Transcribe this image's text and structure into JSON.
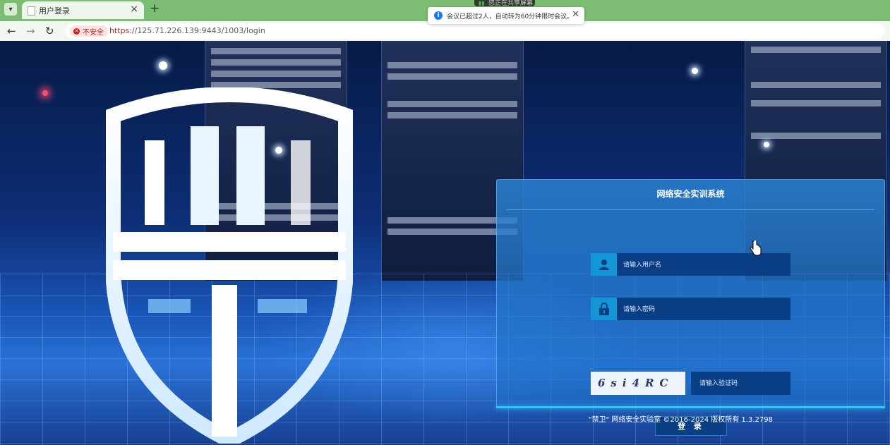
{
  "browser": {
    "tab_title": "用户登录",
    "tab_close": "×",
    "new_tab": "+",
    "share_indicator": "您正在共享屏幕",
    "address": {
      "security_label": "不安全",
      "url_scheme": "https",
      "url_rest": "://125.71.226.139:9443/1003/login"
    }
  },
  "notification": {
    "icon": "i",
    "message": "会议已超过2人，自动转为60分钟限时会议。",
    "close": "✕"
  },
  "login": {
    "system_title": "网络安全实训系统",
    "username_placeholder": "请输入用户名",
    "password_placeholder": "请输入密码",
    "captcha_text": "6si4RC",
    "captcha_placeholder": "请输入验证码",
    "submit_label": "登 录"
  },
  "footer": {
    "copyright": "\"禁卫\" 网络安全实验室  ©2016-2024 版权所有 1.3.2798"
  },
  "icons": {
    "user": "user-icon",
    "lock": "lock-icon",
    "back": "←",
    "forward": "→",
    "reload": "↻"
  },
  "colors": {
    "accent": "#2fc9ff",
    "insecure": "#c5221f",
    "tab_bar": "#7bbd72"
  }
}
